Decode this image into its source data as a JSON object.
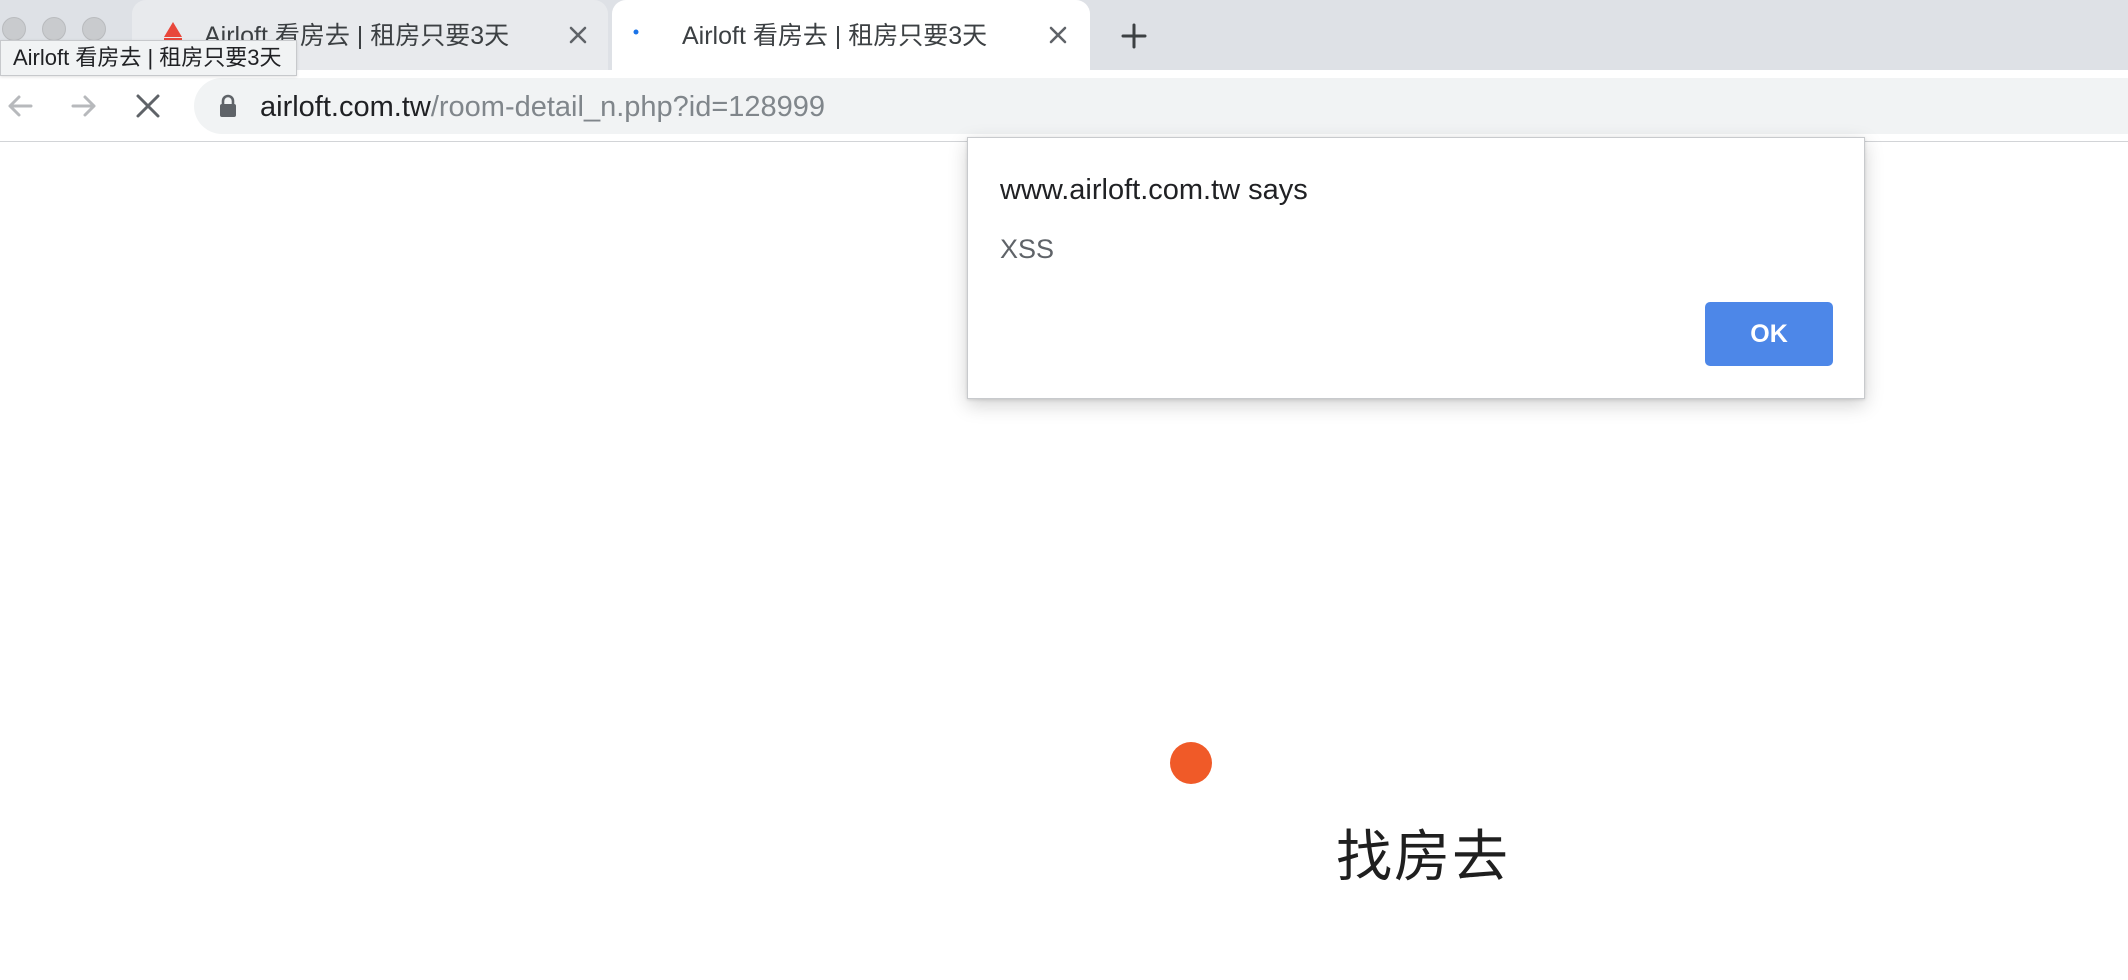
{
  "tabs": [
    {
      "title": "Airloft 看房去 | 租房只要3天",
      "active": false,
      "favicon": "airloft-logo-icon",
      "close_icon": "close-icon"
    },
    {
      "title": "Airloft 看房去 | 租房只要3天",
      "active": true,
      "favicon": "loading-spinner-icon",
      "close_icon": "close-icon"
    }
  ],
  "tooltip": {
    "text": "Airloft 看房去 | 租房只要3天"
  },
  "toolbar": {
    "back_icon": "arrow-left-icon",
    "forward_icon": "arrow-right-icon",
    "stop_icon": "close-icon",
    "lock_icon": "lock-icon",
    "url_host": "airloft.com.tw",
    "url_path": "/room-detail_n.php?id=128999"
  },
  "dialog": {
    "title": "www.airloft.com.tw says",
    "message": "XSS",
    "ok_label": "OK"
  },
  "page": {
    "heading": "找房去"
  },
  "colors": {
    "accent": "#4d87e8",
    "loading_dot": "#f05a28",
    "favicon_red": "#e8473b",
    "spinner_blue": "#1a73e8"
  }
}
